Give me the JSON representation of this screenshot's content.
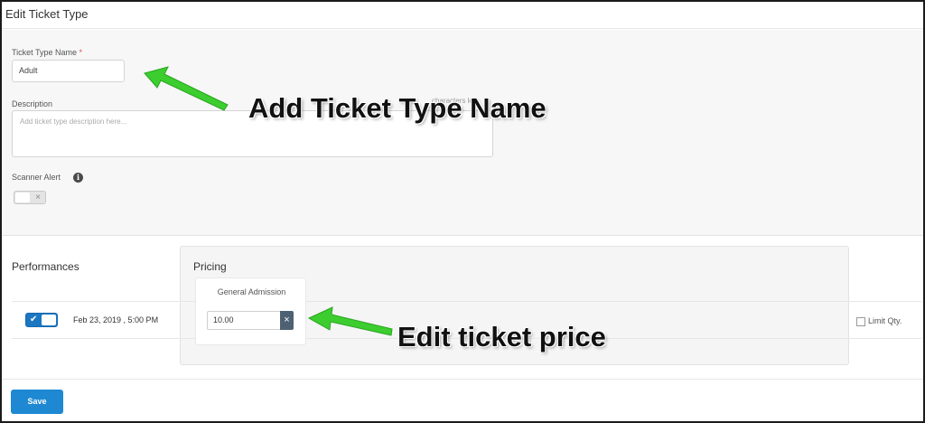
{
  "header": {
    "title": "Edit Ticket Type"
  },
  "form": {
    "ticket_type_name_label": "Ticket Type Name",
    "required_marker": "*",
    "ticket_type_name_value": "Adult",
    "description_label": "Description",
    "description_placeholder": "Add ticket type description here...",
    "description_charcount": "characters left",
    "scanner_alert_label": "Scanner Alert",
    "scanner_alert_enabled": false
  },
  "performances": {
    "title": "Performances",
    "rows": [
      {
        "enabled": true,
        "date": "Feb 23, 2019 , 5:00 PM",
        "limit_qty_label": "Limit Qty.",
        "limit_qty_checked": false
      }
    ]
  },
  "pricing": {
    "title": "Pricing",
    "columns": [
      {
        "label": "General Admission",
        "price": "10.00"
      }
    ]
  },
  "footer": {
    "save_label": "Save"
  },
  "annotations": {
    "name_callout": "Add Ticket Type Name",
    "price_callout": "Edit ticket price",
    "arrow_color": "#3ccd2f"
  }
}
